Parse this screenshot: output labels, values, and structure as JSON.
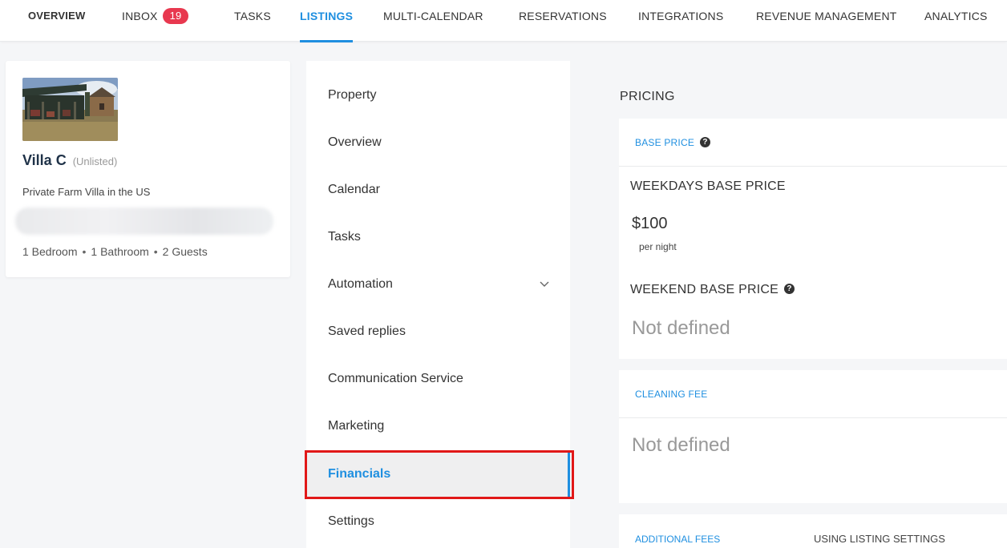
{
  "nav": {
    "items": [
      {
        "label": "OVERVIEW"
      },
      {
        "label": "INBOX",
        "badge": "19"
      },
      {
        "label": "TASKS"
      },
      {
        "label": "LISTINGS"
      },
      {
        "label": "MULTI-CALENDAR"
      },
      {
        "label": "RESERVATIONS"
      },
      {
        "label": "INTEGRATIONS"
      },
      {
        "label": "REVENUE MANAGEMENT"
      },
      {
        "label": "ANALYTICS"
      }
    ],
    "active": "LISTINGS"
  },
  "listing": {
    "title": "Villa C",
    "status": "(Unlisted)",
    "subtitle": "Private Farm Villa in the US",
    "bedrooms": "1 Bedroom",
    "bathrooms": "1 Bathroom",
    "guests": "2 Guests"
  },
  "menu": {
    "items": [
      {
        "label": "Property"
      },
      {
        "label": "Overview"
      },
      {
        "label": "Calendar"
      },
      {
        "label": "Tasks"
      },
      {
        "label": "Automation",
        "icon": "chevron-down-icon"
      },
      {
        "label": "Saved replies"
      },
      {
        "label": "Communication Service"
      },
      {
        "label": "Marketing"
      },
      {
        "label": "Financials"
      },
      {
        "label": "Settings"
      }
    ],
    "active": "Financials"
  },
  "pricing": {
    "heading": "PRICING",
    "base_price": {
      "header": "BASE PRICE",
      "weekdays_label": "WEEKDAYS BASE PRICE",
      "weekdays_value": "$100",
      "weekdays_unit": "per night",
      "weekend_label": "WEEKEND BASE PRICE",
      "weekend_value": "Not defined"
    },
    "cleaning_fee": {
      "header": "CLEANING FEE",
      "value": "Not defined"
    },
    "additional_fees": {
      "header": "ADDITIONAL FEES",
      "settings": "USING LISTING SETTINGS"
    }
  },
  "colors": {
    "accent": "#1f8fe0",
    "badge": "#e8384f",
    "highlight": "#e11818"
  }
}
